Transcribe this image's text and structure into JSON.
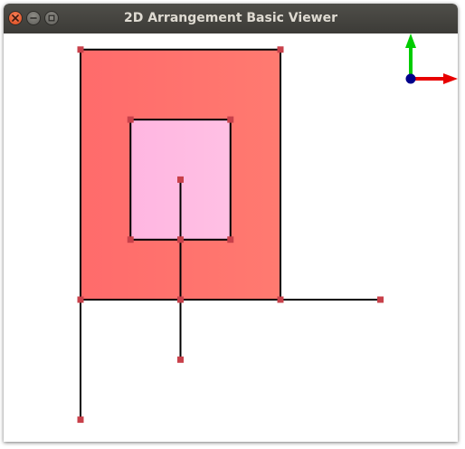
{
  "window": {
    "title": "2D Arrangement Basic Viewer",
    "controls": [
      "close-icon",
      "minimize-icon",
      "maximize-icon"
    ]
  },
  "colors": {
    "titlebar": "#3c3b37",
    "title_text": "#dfdbd2",
    "close_button": "#e9541f",
    "outer_face": "#ff6b6b",
    "inner_face": "#ffb6e1",
    "edge": "#000000",
    "vertex": "#c8404a",
    "axis_x": "#e80000",
    "axis_y": "#00cc00",
    "axis_origin": "#00008b"
  },
  "arrangement": {
    "vertices": [
      {
        "id": "v0",
        "x": 0,
        "y": 0
      },
      {
        "id": "v1",
        "x": 4,
        "y": 0
      },
      {
        "id": "v2",
        "x": 4,
        "y": 5
      },
      {
        "id": "v3",
        "x": 0,
        "y": 5
      },
      {
        "id": "v4",
        "x": 1,
        "y": 1.2
      },
      {
        "id": "v5",
        "x": 3,
        "y": 1.2
      },
      {
        "id": "v6",
        "x": 3,
        "y": 3.6
      },
      {
        "id": "v7",
        "x": 1,
        "y": 3.6
      },
      {
        "id": "v8",
        "x": 2,
        "y": 2.4
      },
      {
        "id": "v9",
        "x": 2,
        "y": 1.2
      },
      {
        "id": "v10",
        "x": 2,
        "y": 0
      },
      {
        "id": "v11",
        "x": 2,
        "y": -1.2
      },
      {
        "id": "v12",
        "x": 6,
        "y": 0
      },
      {
        "id": "v13",
        "x": 0,
        "y": -2.4
      }
    ],
    "edges": [
      [
        "v0",
        "v10"
      ],
      [
        "v10",
        "v1"
      ],
      [
        "v1",
        "v2"
      ],
      [
        "v2",
        "v3"
      ],
      [
        "v3",
        "v0"
      ],
      [
        "v4",
        "v9"
      ],
      [
        "v9",
        "v5"
      ],
      [
        "v5",
        "v6"
      ],
      [
        "v6",
        "v7"
      ],
      [
        "v7",
        "v4"
      ],
      [
        "v8",
        "v9"
      ],
      [
        "v9",
        "v10"
      ],
      [
        "v10",
        "v11"
      ],
      [
        "v1",
        "v12"
      ],
      [
        "v0",
        "v13"
      ]
    ],
    "faces": [
      {
        "id": "outer-face",
        "boundary": [
          "v0",
          "v1",
          "v2",
          "v3"
        ],
        "hole": [
          "v4",
          "v5",
          "v6",
          "v7"
        ],
        "color": "#ff6b6b"
      },
      {
        "id": "inner-face",
        "boundary": [
          "v4",
          "v5",
          "v6",
          "v7"
        ],
        "color": "#ffb6e1"
      }
    ]
  }
}
